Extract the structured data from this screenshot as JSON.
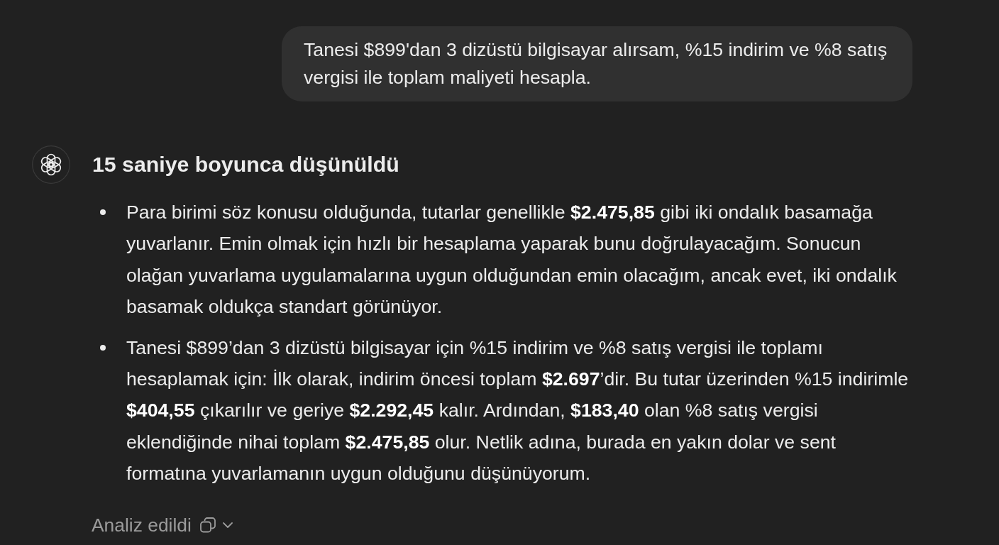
{
  "user_message": {
    "text": "Tanesi $899'dan 3 dizüstü bilgisayar alırsam, %15 indirim ve %8 satış vergisi ile toplam maliyeti hesapla."
  },
  "assistant": {
    "thinking_title": "15 saniye boyunca düşünüldü",
    "thoughts": [
      "Para birimi söz konusu olduğunda, tutarlar genellikle **$2.475,85** gibi iki ondalık basamağa yuvarlanır. Emin olmak için hızlı bir hesaplama yaparak bunu doğrulayacağım. Sonucun olağan yuvarlama uygulamalarına uygun olduğundan emin olacağım, ancak evet, iki ondalık basamak oldukça standart görünüyor.",
      "Tanesi $899’dan 3 dizüstü bilgisayar için %15 indirim ve %8 satış vergisi ile toplamı hesaplamak için: İlk olarak, indirim öncesi toplam **$2.697**’dir. Bu tutar üzerinden %15 indirimle **$404,55** çıkarılır ve geriye **$2.292,45** kalır. Ardından, **$183,40** olan %8 satış vergisi eklendiğinde nihai toplam **$2.475,85** olur. Netlik adına, burada en yakın dolar ve sent formatına yuvarlamanın uygun olduğunu düşünüyorum."
    ],
    "footer": {
      "label": "Analiz edildi"
    }
  }
}
